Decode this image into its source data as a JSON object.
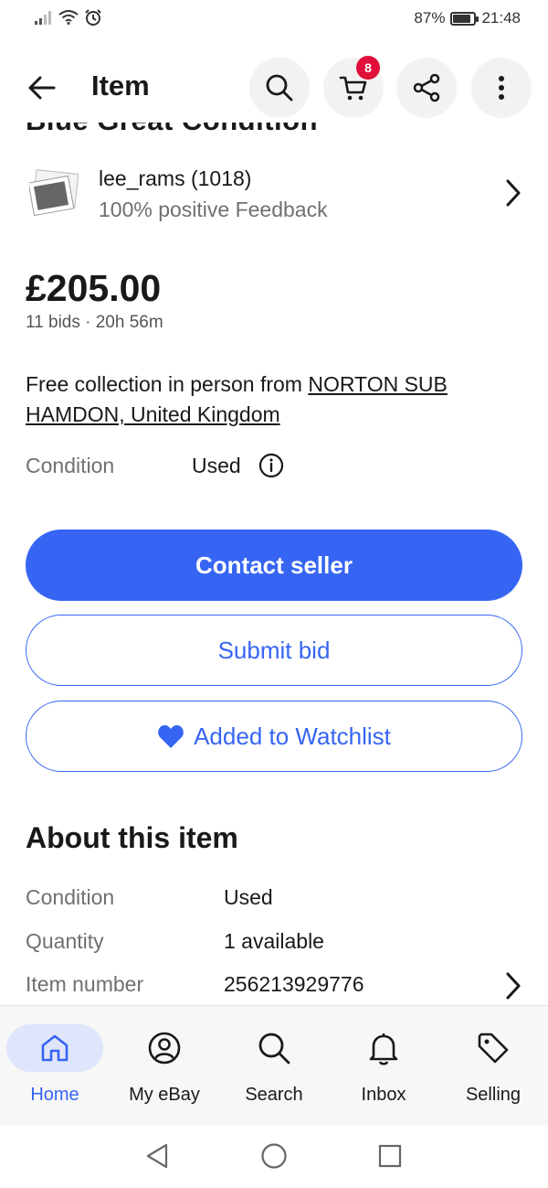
{
  "status_bar": {
    "battery": "87%",
    "battery_level": 0.87,
    "time": "21:48"
  },
  "app_bar": {
    "title": "Item",
    "cart_count": "8"
  },
  "item": {
    "cut_title": "Blue Great Condition",
    "seller": {
      "name": "lee_rams (1018)",
      "feedback": "100% positive Feedback"
    },
    "price": "£205.00",
    "bids_time": "11 bids · 20h 56m",
    "collection_prefix": "Free collection in person from ",
    "collection_location": "NORTON SUB HAMDON, United Kingdom",
    "condition_label": "Condition",
    "condition_value": "Used"
  },
  "actions": {
    "contact": "Contact seller",
    "bid": "Submit bid",
    "watchlist": "Added to Watchlist"
  },
  "about": {
    "heading": "About this item",
    "rows": [
      {
        "label": "Condition",
        "value": "Used"
      },
      {
        "label": "Quantity",
        "value": "1 available"
      },
      {
        "label": "Item number",
        "value": "256213929776"
      }
    ]
  },
  "bottom_nav": {
    "items": [
      {
        "label": "Home",
        "icon": "home-icon",
        "active": true
      },
      {
        "label": "My eBay",
        "icon": "account-icon"
      },
      {
        "label": "Search",
        "icon": "search-icon"
      },
      {
        "label": "Inbox",
        "icon": "bell-icon"
      },
      {
        "label": "Selling",
        "icon": "tag-icon"
      }
    ]
  },
  "colors": {
    "accent": "#3665f3",
    "badge": "#e0103a",
    "text": "#191919",
    "muted": "#707070"
  }
}
